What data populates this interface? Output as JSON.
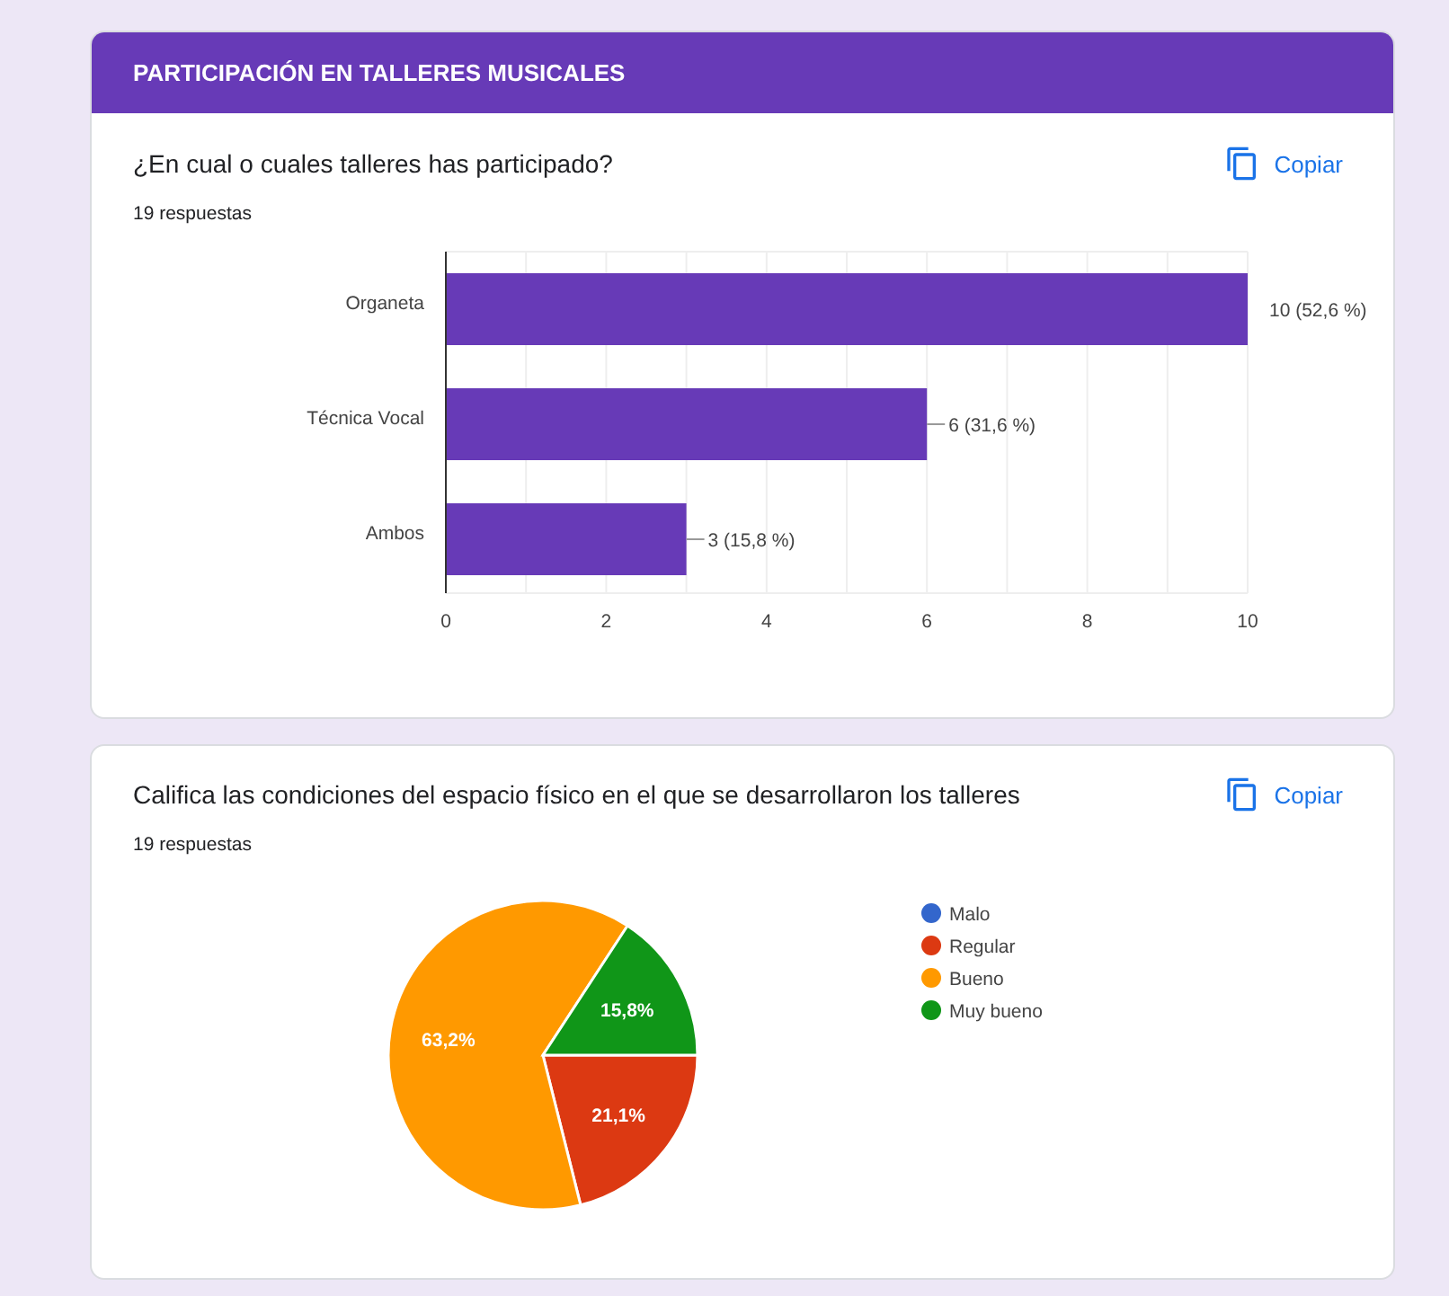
{
  "section": {
    "title": "PARTICIPACIÓN EN TALLERES MUSICALES"
  },
  "questions": [
    {
      "title": "¿En cual o cuales talleres has participado?",
      "responses": "19 respuestas",
      "copy_label": "Copiar",
      "chart_data": {
        "type": "bar",
        "orientation": "horizontal",
        "categories": [
          "Organeta",
          "Técnica Vocal",
          "Ambos"
        ],
        "series": [
          {
            "color": "#673ab7",
            "values": [
              10,
              6,
              3
            ]
          }
        ],
        "grid": true,
        "value_labels": [
          "10 (52,6 %)",
          "6 (31,6 %)",
          "3 (15,8 %)"
        ],
        "xlim": [
          0,
          10
        ],
        "xticks": [
          0,
          2,
          4,
          6,
          8,
          10
        ]
      }
    },
    {
      "title": "Califica las condiciones del espacio físico en el que se desarrollaron los talleres",
      "responses": "19 respuestas",
      "copy_label": "Copiar",
      "chart_data": {
        "type": "pie",
        "categories": [
          "Malo",
          "Regular",
          "Bueno",
          "Muy bueno"
        ],
        "series": [
          {
            "values": [
              0,
              21.1,
              63.2,
              15.8
            ]
          }
        ],
        "legend": "right",
        "colors": [
          "#3366cc",
          "#dc3912",
          "#ff9900",
          "#109618"
        ],
        "value_labels": [
          null,
          "21,1%",
          "63,2%",
          "15,8%"
        ]
      }
    }
  ]
}
